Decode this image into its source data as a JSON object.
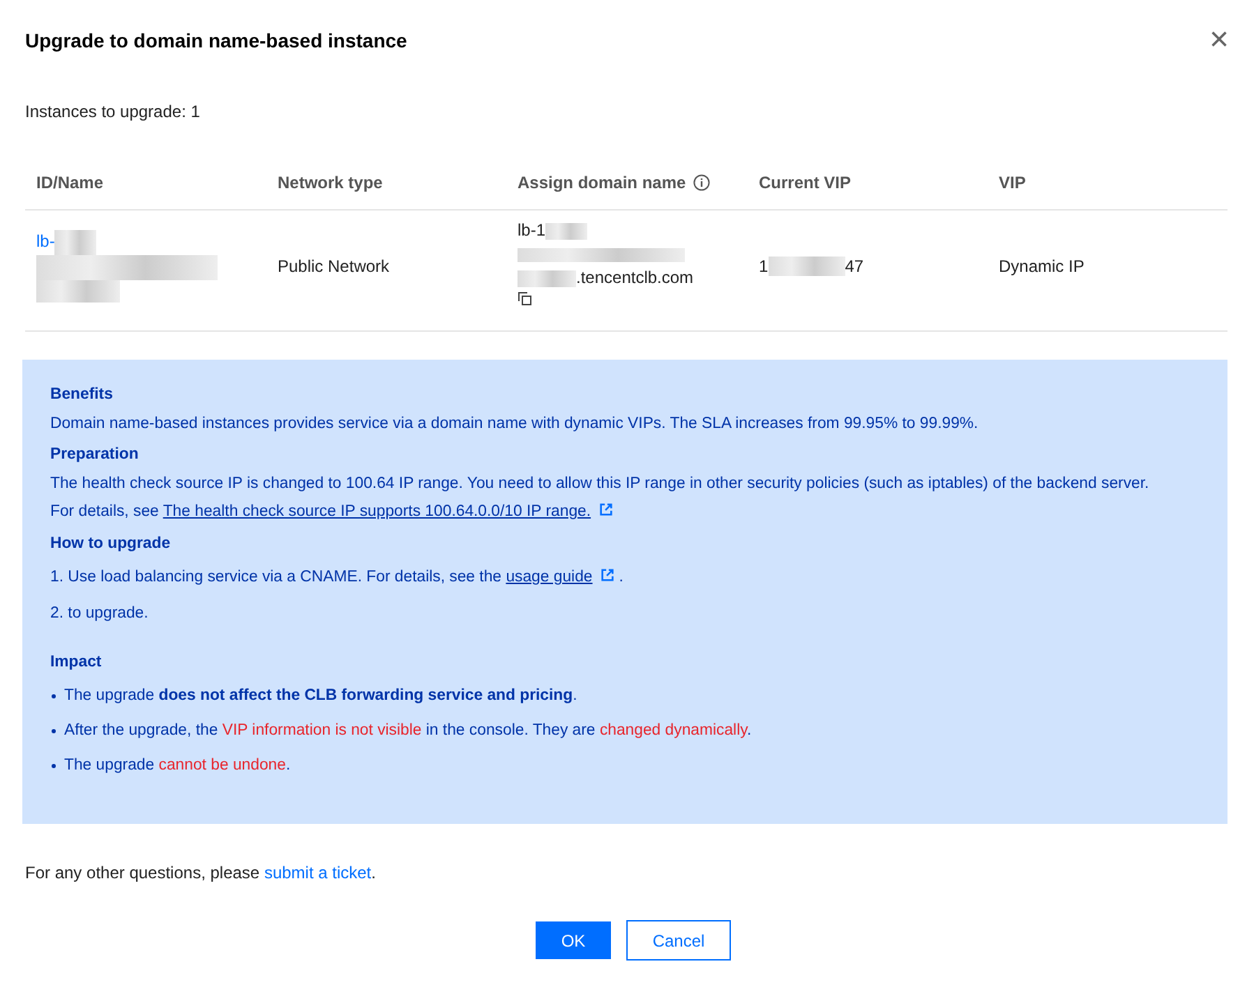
{
  "dialog": {
    "title": "Upgrade to domain name-based instance",
    "close": "×"
  },
  "count_label": "Instances to upgrade: 1",
  "table": {
    "columns": [
      {
        "label": "ID/Name",
        "kind": "plain"
      },
      {
        "label": "Network type",
        "kind": "plain"
      },
      {
        "label": "Assign domain name",
        "kind": "info"
      },
      {
        "label": "Current VIP",
        "kind": "plain"
      },
      {
        "label": "VIP",
        "kind": "plain"
      }
    ],
    "rows": [
      {
        "id": "lb-",
        "network": "Public Network",
        "domain_first": "lb-1",
        "domain_last": ".tencentclb.com",
        "vip_start": "1",
        "vip_end": "47",
        "vip": "Dynamic IP"
      }
    ]
  },
  "notice": {
    "sections": [
      {
        "heading": "Benefits",
        "lines": [
          {
            "kind": "text",
            "text": "Domain name-based instances provides service via a domain name with dynamic VIPs. The SLA increases from 99.95% to 99.99%."
          }
        ]
      },
      {
        "heading": "Preparation",
        "lines": [
          {
            "kind": "text",
            "text": "The health check source IP is changed to 100.64 IP range. You need to allow this IP range in other security policies (such as iptables) of the backend server."
          },
          {
            "kind": "link",
            "text": "For details, see ",
            "link": "The health check source IP supports 100.64.0.0/10 IP range."
          }
        ]
      },
      {
        "heading": "How to upgrade",
        "lines": [
          {
            "kind": "link",
            "text": "1. Use load balancing service via a CNAME. For details, see the ",
            "link": "usage guide",
            "after": "."
          },
          {
            "kind": "text",
            "text": "2. to upgrade."
          }
        ]
      },
      {
        "heading": "Impact",
        "lines": [
          {
            "kind": "bullet",
            "segments": [
              {
                "kind": "plain",
                "text": "The upgrade "
              },
              {
                "kind": "strong",
                "text": "does not affect the CLB forwarding service and pricing"
              },
              {
                "kind": "plain",
                "text": "."
              }
            ]
          },
          {
            "kind": "bullet",
            "segments": [
              {
                "kind": "plain",
                "text": "After the upgrade, the "
              },
              {
                "kind": "warning",
                "text": "VIP information is not visible"
              },
              {
                "kind": "plain",
                "text": " in the console. They are "
              },
              {
                "kind": "warning",
                "text": "changed dynamically"
              },
              {
                "kind": "plain",
                "text": "."
              }
            ]
          },
          {
            "kind": "bullet",
            "segments": [
              {
                "kind": "plain",
                "text": "The upgrade "
              },
              {
                "kind": "warning",
                "text": "cannot be undone"
              },
              {
                "kind": "plain",
                "text": "."
              }
            ]
          }
        ]
      }
    ]
  },
  "footer": {
    "text": "For any other questions, please ",
    "link": "submit a ticket",
    "after": "."
  },
  "buttons": [
    {
      "label": "OK",
      "kind": "primary"
    },
    {
      "label": "Cancel",
      "kind": "secondary"
    }
  ]
}
